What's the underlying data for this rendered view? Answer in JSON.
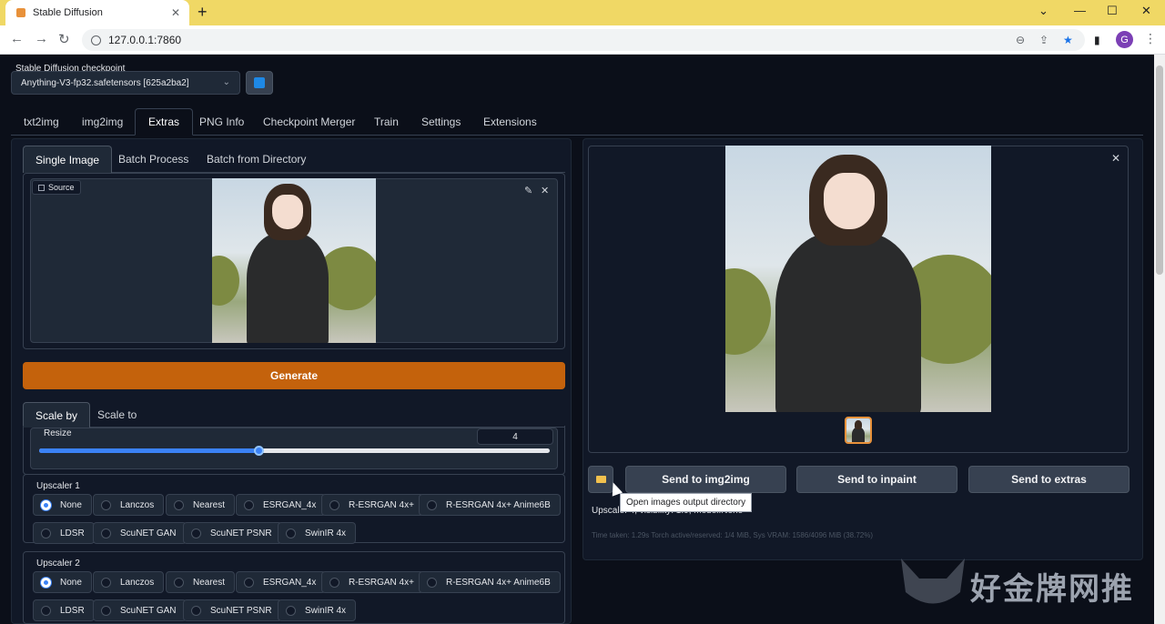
{
  "browser": {
    "tab_title": "Stable Diffusion",
    "url": "127.0.0.1:7860",
    "profile_initial": "G"
  },
  "checkpoint": {
    "label": "Stable Diffusion checkpoint",
    "value": "Anything-V3-fp32.safetensors [625a2ba2]"
  },
  "main_tabs": [
    "txt2img",
    "img2img",
    "Extras",
    "PNG Info",
    "Checkpoint Merger",
    "Train",
    "Settings",
    "Extensions"
  ],
  "active_main_tab": "Extras",
  "sub_tabs": [
    "Single Image",
    "Batch Process",
    "Batch from Directory"
  ],
  "source_label": "Source",
  "generate_label": "Generate",
  "scale_tabs": [
    "Scale by",
    "Scale to"
  ],
  "resize": {
    "label": "Resize",
    "value": "4",
    "slider_fraction": 0.43
  },
  "upscaler1": {
    "label": "Upscaler 1",
    "options": [
      "None",
      "Lanczos",
      "Nearest",
      "ESRGAN_4x",
      "R-ESRGAN 4x+",
      "R-ESRGAN 4x+ Anime6B",
      "LDSR",
      "ScuNET GAN",
      "ScuNET PSNR",
      "SwinIR 4x"
    ],
    "selected": "None"
  },
  "upscaler2": {
    "label": "Upscaler 2",
    "options": [
      "None",
      "Lanczos",
      "Nearest",
      "ESRGAN_4x",
      "R-ESRGAN 4x+",
      "R-ESRGAN 4x+ Anime6B",
      "LDSR",
      "ScuNET GAN",
      "ScuNET PSNR",
      "SwinIR 4x"
    ],
    "selected": "None"
  },
  "output": {
    "send_buttons": [
      "Send to img2img",
      "Send to inpaint",
      "Send to extras"
    ],
    "tooltip": "Open images output directory",
    "info": "Upscale: 4, visibility: 1.0, model:None",
    "time": "Time taken: 1.29s  Torch active/reserved: 1/4 MiB, Sys VRAM: 1586/4096 MiB (38.72%)"
  },
  "watermark_text": "好金牌网推",
  "colors": {
    "accent": "#c4620c",
    "slider": "#3b82f6",
    "background": "#0b0f19"
  }
}
